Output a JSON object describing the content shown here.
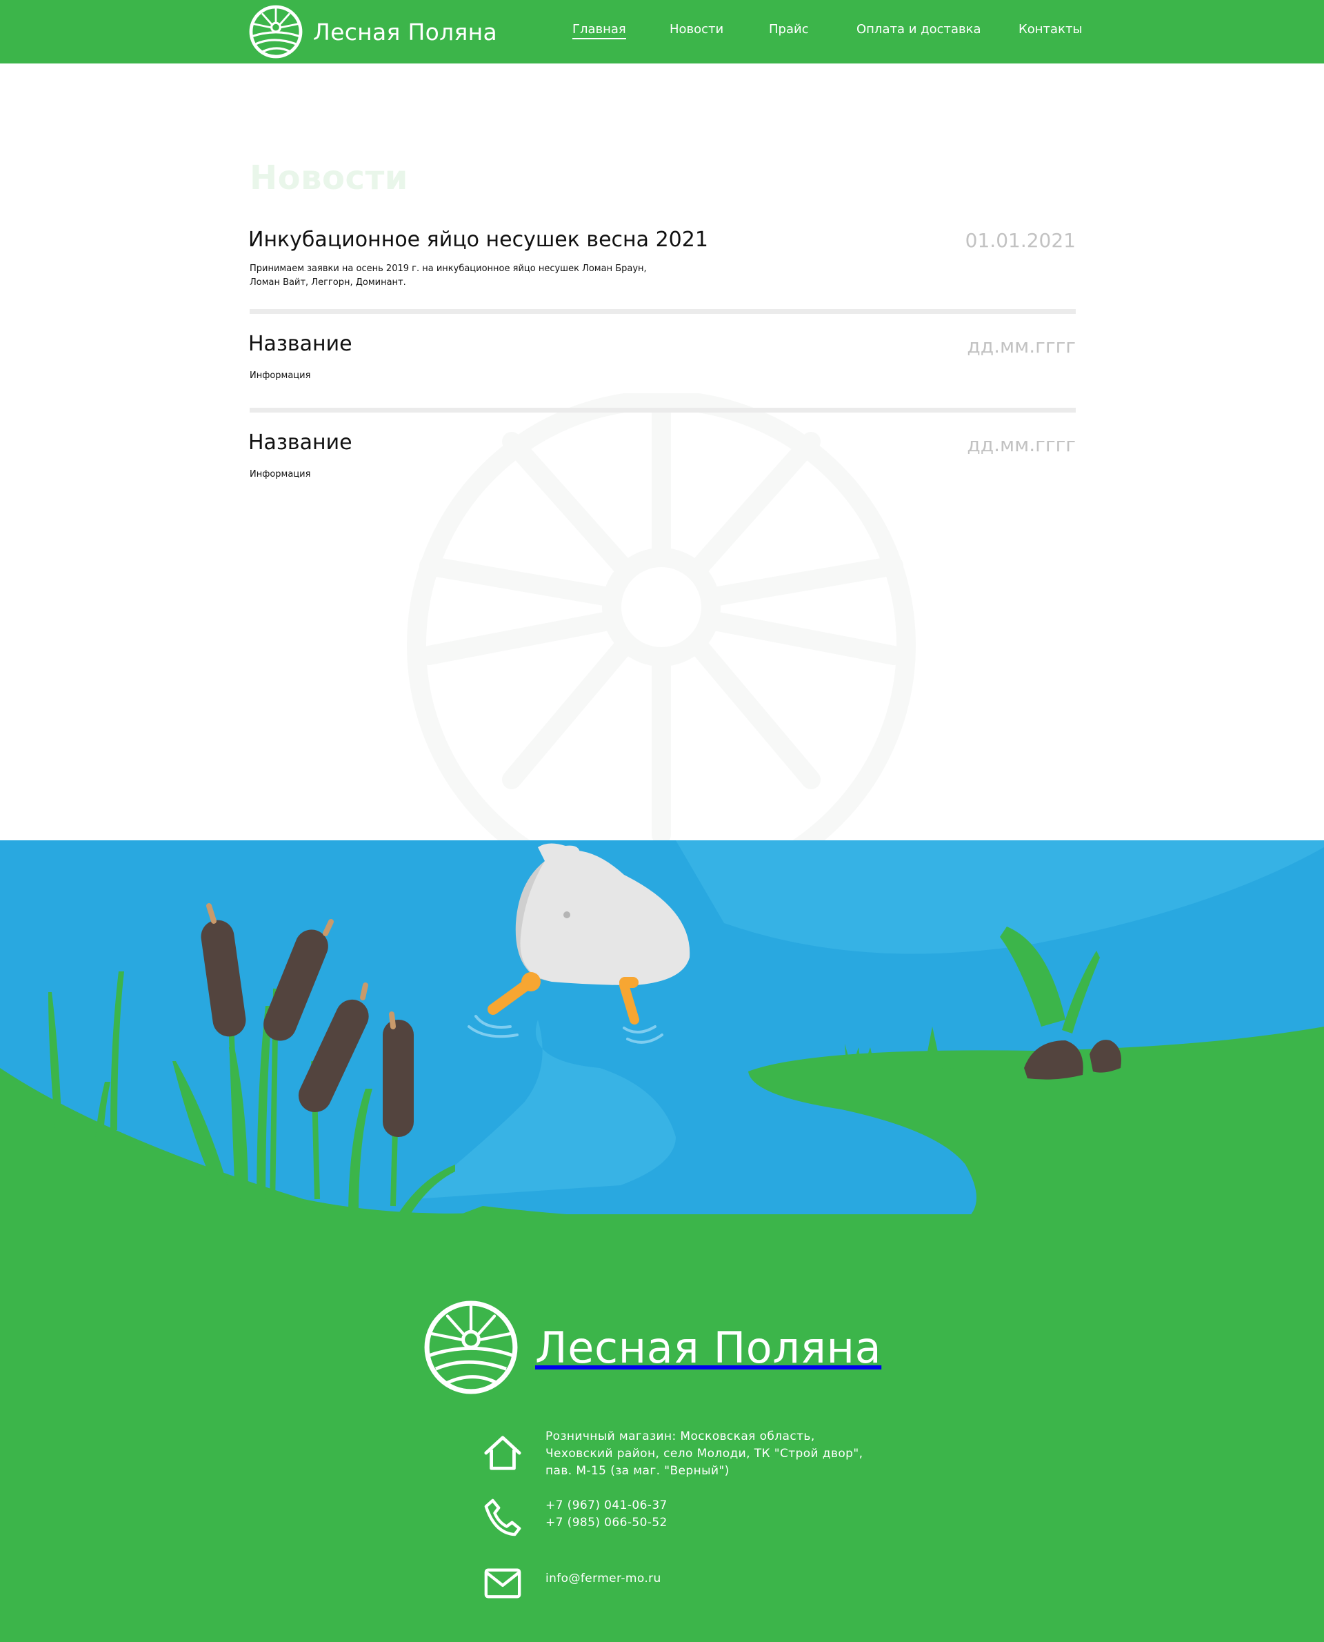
{
  "header": {
    "logo_text": "Лесная Поляна",
    "nav": [
      {
        "label": "Главная",
        "active": true
      },
      {
        "label": "Новости"
      },
      {
        "label": "Прайс"
      },
      {
        "label": "Оплата и доставка"
      },
      {
        "label": "Контакты"
      }
    ]
  },
  "main": {
    "title": "Новости",
    "news": [
      {
        "title": "Инкубационное яйцо несушек весна 2021",
        "date": "01.01.2021",
        "text_lines": [
          "Принимаем заявки на осень 2019 г. на инкубационное яйцо несушек Ломан Браун,",
          "Ломан Вайт, Леггорн, Доминант."
        ]
      },
      {
        "title": "Название",
        "date": "дд.мм.гггг",
        "text_lines": [
          "Информация"
        ]
      },
      {
        "title": "Название",
        "date": "дд.мм.гггг",
        "text_lines": [
          "Информация"
        ]
      }
    ]
  },
  "footer": {
    "logo_text": "Лесная Поляна",
    "address_lines": [
      "Розничный магазин: Московская область,",
      "Чеховский район, село Молоди, ТК \"Строй двор\",",
      "пав. М-15 (за маг. \"Верный\")"
    ],
    "phones": [
      "+7 (967) 041-06-37",
      "+7 (985) 066-50-52"
    ],
    "email": "info@fermer-mo.ru"
  },
  "icons": {
    "logo": "sun-over-field-icon",
    "address": "house-icon",
    "phone": "phone-icon",
    "email": "envelope-icon"
  },
  "colors": {
    "brand_green": "#3cb54a",
    "water_blue": "#29a8e0",
    "date_gray": "#c2c2c2",
    "title_faint": "#e9f6ea",
    "cattail_brown": "#53443e",
    "duck_white": "#e6e6e6",
    "duck_feet": "#f7a632"
  }
}
